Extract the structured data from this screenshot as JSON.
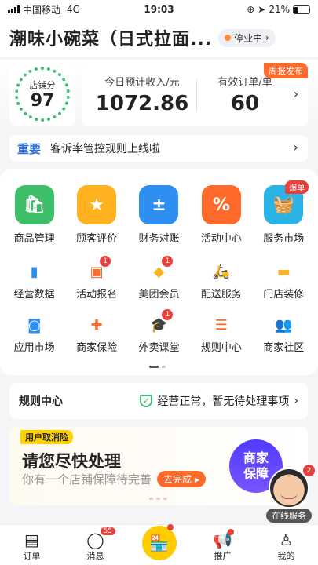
{
  "status_bar": {
    "carrier": "中国移动",
    "network": "4G",
    "time": "19:03",
    "battery": "21%"
  },
  "header": {
    "store_name": "潮味小碗菜（日式拉面...",
    "status": "停业中"
  },
  "stats": {
    "score_label": "店铺分",
    "score": "97",
    "revenue_label": "今日预计收入/元",
    "revenue": "1072.86",
    "orders_label": "有效订单/单",
    "orders": "60",
    "weekly_tag": "周报发布"
  },
  "notice": {
    "tag": "重要",
    "text": "客诉率管控规则上线啦"
  },
  "main_tiles": [
    {
      "label": "商品管理",
      "icon": "bag-icon",
      "color": "#3dbf6a"
    },
    {
      "label": "顾客评价",
      "icon": "rating-icon",
      "color": "#ffb21f"
    },
    {
      "label": "财务对账",
      "icon": "calculator-icon",
      "color": "#2f8ff0"
    },
    {
      "label": "活动中心",
      "icon": "coupon-icon",
      "color": "#ff6a2b"
    },
    {
      "label": "服务市场",
      "icon": "basket-icon",
      "color": "#2ab3e6",
      "badge": "爆单"
    }
  ],
  "tools_row1": [
    {
      "label": "经营数据",
      "icon": "bar-chart-icon"
    },
    {
      "label": "活动报名",
      "icon": "calendar-icon",
      "badge": "1"
    },
    {
      "label": "美团会员",
      "icon": "vip-icon",
      "badge": "1"
    },
    {
      "label": "配送服务",
      "icon": "scooter-icon"
    },
    {
      "label": "门店装修",
      "icon": "paint-roller-icon"
    }
  ],
  "tools_row2": [
    {
      "label": "应用市场",
      "icon": "shopping-bag-icon"
    },
    {
      "label": "商家保险",
      "icon": "insurance-icon"
    },
    {
      "label": "外卖课堂",
      "icon": "graduation-cap-icon",
      "badge": "1"
    },
    {
      "label": "规则中心",
      "icon": "list-icon"
    },
    {
      "label": "商家社区",
      "icon": "community-icon"
    }
  ],
  "rules": {
    "title": "规则中心",
    "status": "经营正常，暂无待处理事项"
  },
  "promo": {
    "tag": "用户取消险",
    "title": "请您尽快处理",
    "subtitle": "你有一个店铺保障待完善",
    "button": "去完成",
    "circle_line1": "商家",
    "circle_line2": "保障"
  },
  "assistant": {
    "label": "在线服务",
    "badge": "2"
  },
  "tabbar": [
    {
      "label": "订单",
      "icon": "order-icon"
    },
    {
      "label": "消息",
      "icon": "chat-icon",
      "badge": "55"
    },
    {
      "label": "",
      "icon": "store-icon"
    },
    {
      "label": "推广",
      "icon": "megaphone-icon"
    },
    {
      "label": "我的",
      "icon": "profile-icon"
    }
  ]
}
